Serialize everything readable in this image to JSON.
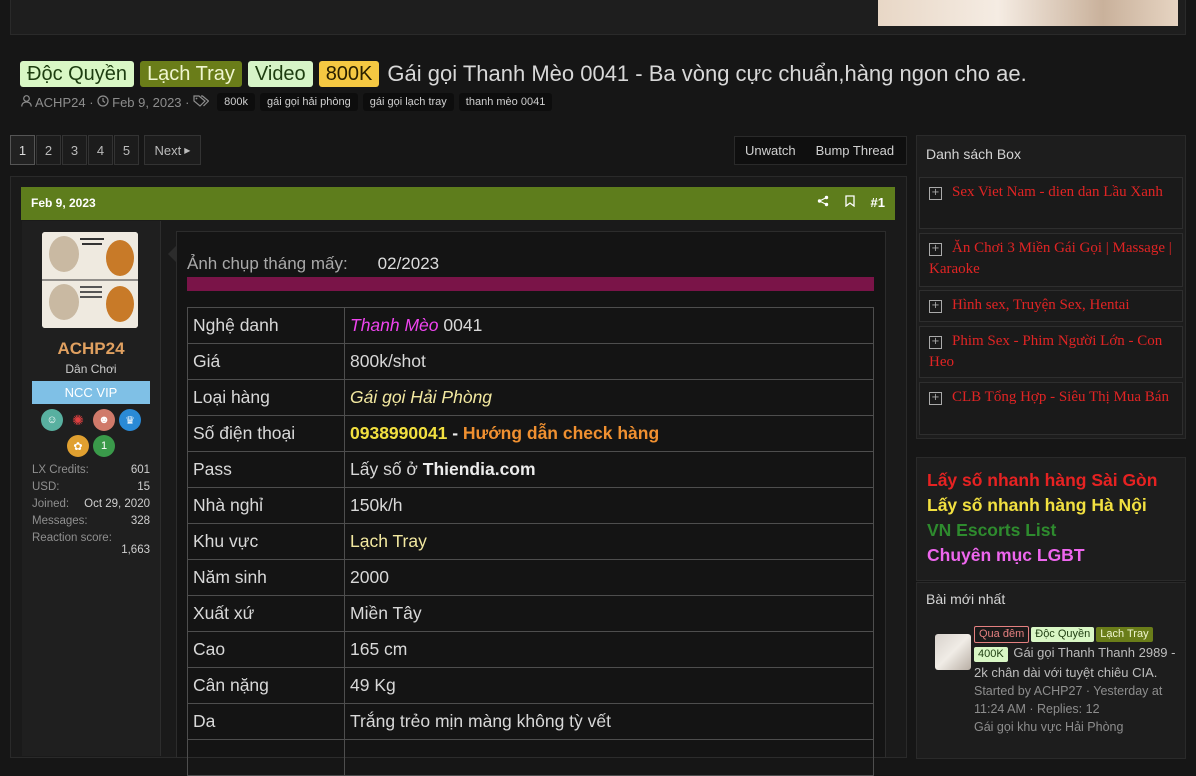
{
  "thread": {
    "labels": [
      "Độc Quyền",
      "Lạch Tray",
      "Video",
      "800K"
    ],
    "title": "Gái gọi Thanh Mèo 0041 - Ba vòng cực chuẩn,hàng ngon cho ae.",
    "author": "ACHP24",
    "date": "Feb 9, 2023",
    "tags": [
      "800k",
      "gái gọi hải phòng",
      "gái gọi lạch tray",
      "thanh mèo 0041"
    ]
  },
  "pagination": {
    "pages": [
      "1",
      "2",
      "3",
      "4",
      "5"
    ],
    "current": "1",
    "next": "Next"
  },
  "actions": {
    "unwatch": "Unwatch",
    "bump": "Bump Thread"
  },
  "post": {
    "date": "Feb 9, 2023",
    "number": "#1",
    "user": {
      "name": "ACHP24",
      "title": "Dân Chơi",
      "badge": "NCC VIP",
      "stats": [
        {
          "label": "LX Credits:",
          "value": "601"
        },
        {
          "label": "USD:",
          "value": "15"
        },
        {
          "label": "Joined:",
          "value": "Oct 29, 2020"
        },
        {
          "label": "Messages:",
          "value": "328"
        },
        {
          "label": "Reaction score:",
          "value": "1,663"
        }
      ]
    },
    "photo_question": "Ảnh chụp tháng mấy:",
    "photo_answer": "02/2023",
    "table": {
      "nick_k": "Nghệ danh",
      "nick_v1": "Thanh Mèo",
      "nick_v2": " 0041",
      "price_k": "Giá",
      "price_v": "800k/shot",
      "type_k": "Loại hàng",
      "type_v": "Gái gọi Hải Phòng",
      "phone_k": "Số điện thoại",
      "phone_v": "0938990041",
      "phone_sep": " - ",
      "phone_link": "Hướng dẫn check hàng",
      "pass_k": "Pass",
      "pass_v1": "Lấy số ở ",
      "pass_v2": "Thiendia.com",
      "motel_k": "Nhà nghỉ",
      "motel_v": "150k/h",
      "area_k": "Khu vực",
      "area_v": "Lạch Tray",
      "born_k": "Năm sinh",
      "born_v": "2000",
      "origin_k": "Xuất xứ",
      "origin_v": "Miền Tây",
      "height_k": "Cao",
      "height_v": "165 cm",
      "weight_k": "Cân nặng",
      "weight_v": "49 Kg",
      "skin_k": "Da",
      "skin_v": "Trắng trẻo mịn màng không tỳ vết"
    }
  },
  "sidebar": {
    "title": "Danh sách Box",
    "boxes": [
      "Sex Viet Nam - dien dan Lầu Xanh",
      "Ăn Chơi 3 Miền Gái Gọi | Massage | Karaoke",
      "Hình sex, Truyện Sex, Hentai",
      "Phim Sex - Phim Người Lớn - Con Heo",
      "CLB Tổng Hợp - Siêu Thị Mua Bán"
    ],
    "links": [
      {
        "text": "Lấy số nhanh hàng Sài Gòn",
        "color": "#e62222"
      },
      {
        "text": "Lấy số nhanh hàng Hà Nội",
        "color": "#f2e040"
      },
      {
        "text": "VN Escorts List",
        "color": "#2e8b2e"
      },
      {
        "text": "Chuyên mục LGBT",
        "color": "#ee66ee"
      }
    ],
    "new_posts": {
      "title": "Bài mới nhất",
      "labels": [
        "Qua đêm",
        "Độc Quyền",
        "Lạch Tray",
        "400K"
      ],
      "thread_title": "Gái gọi Thanh Thanh 2989 - 2k chân dài với tuyệt chiêu CIA.",
      "meta": "Started by ACHP27 · Yesterday at 11:24 AM · Replies: 12",
      "forum": "Gái gọi khu vực Hải Phòng"
    }
  },
  "colors": {
    "post_header": "#5e7d1c",
    "vip_badge": "#7fc0e6",
    "box_link": "#e02424"
  }
}
